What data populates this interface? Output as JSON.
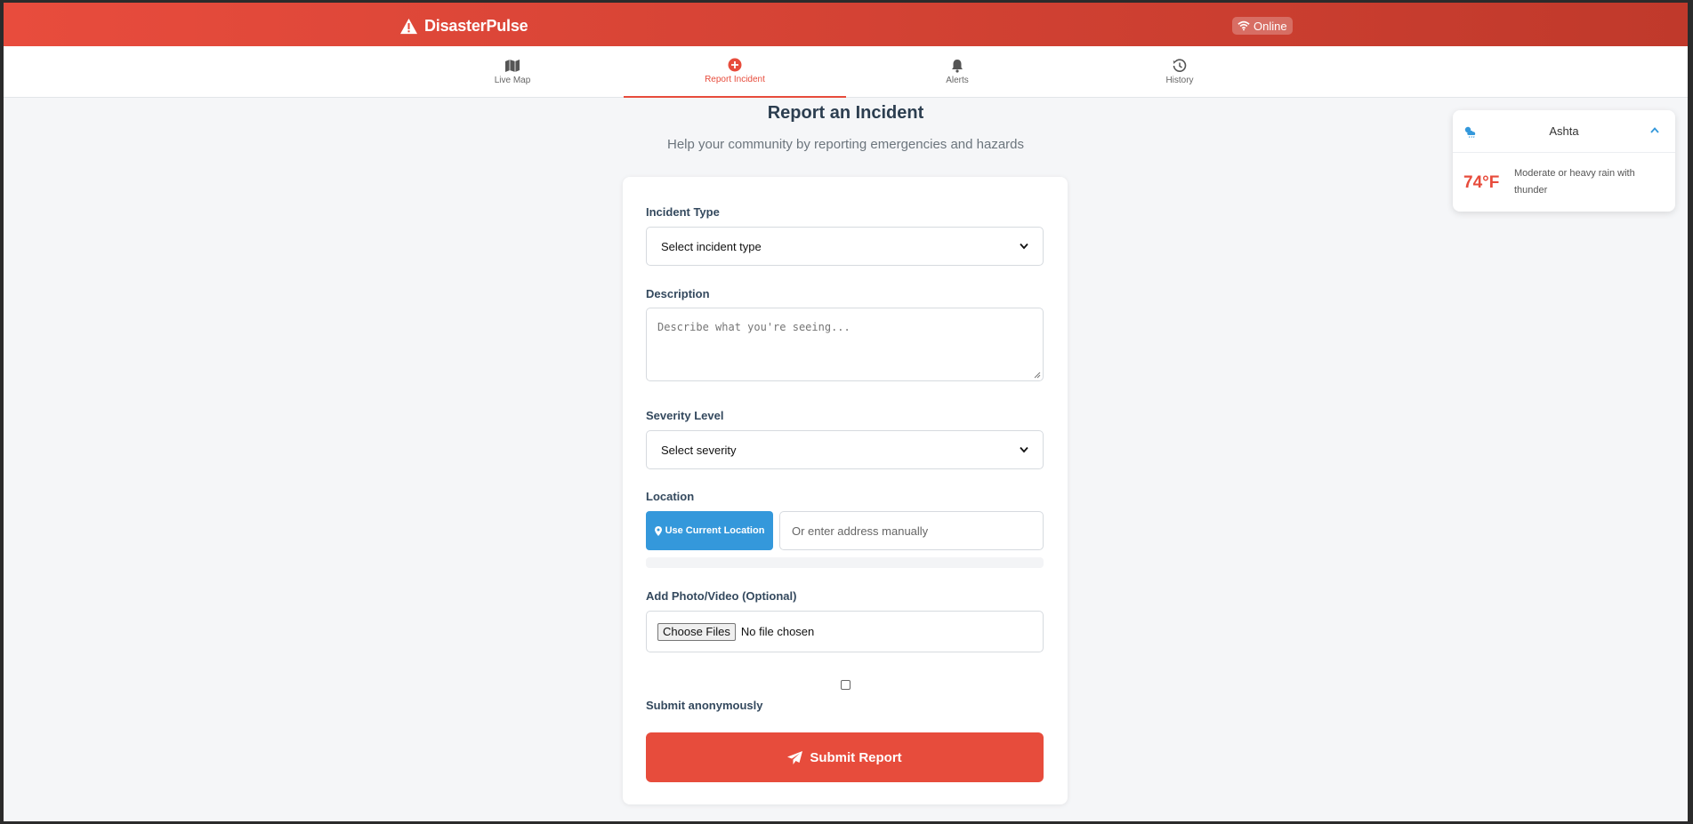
{
  "app": {
    "brand": "DisasterPulse",
    "status": "Online"
  },
  "nav": {
    "tabs": [
      {
        "label": "Live Map",
        "icon": "map-icon",
        "active": false
      },
      {
        "label": "Report Incident",
        "icon": "plus-circle-icon",
        "active": true
      },
      {
        "label": "Alerts",
        "icon": "bell-icon",
        "active": false
      },
      {
        "label": "History",
        "icon": "history-icon",
        "active": false
      }
    ]
  },
  "page": {
    "title": "Report an Incident",
    "subtitle": "Help your community by reporting emergencies and hazards"
  },
  "form": {
    "incident_type": {
      "label": "Incident Type",
      "value": "Select incident type"
    },
    "description": {
      "label": "Description",
      "placeholder": "Describe what you're seeing..."
    },
    "severity": {
      "label": "Severity Level",
      "value": "Select severity"
    },
    "location": {
      "label": "Location",
      "button": "Use Current Location",
      "placeholder": "Or enter address manually"
    },
    "media": {
      "label": "Add Photo/Video (Optional)",
      "button": "Choose Files",
      "status": "No file chosen"
    },
    "anonymous": {
      "label": "Submit anonymously",
      "checked": false
    },
    "submit": "Submit Report"
  },
  "weather": {
    "city": "Ashta",
    "temperature": "74°F",
    "condition": "Moderate or heavy rain with thunder",
    "icon": "cloud-sun-rain-icon"
  },
  "colors": {
    "primary": "#e74c3c",
    "accent": "#3498db",
    "text": "#2c3e50"
  }
}
